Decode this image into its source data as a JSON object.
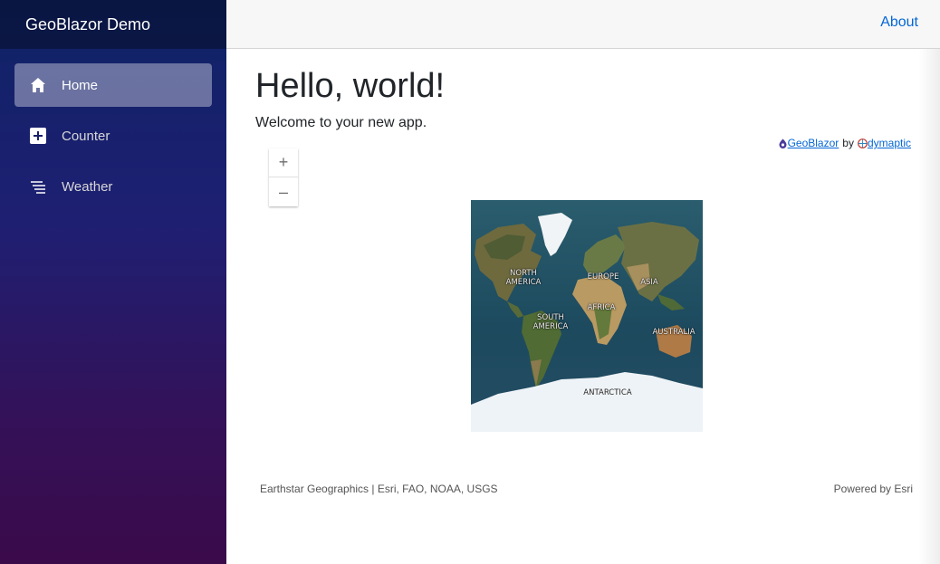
{
  "brand": {
    "title": "GeoBlazor Demo"
  },
  "nav": {
    "items": [
      {
        "label": "Home",
        "icon": "home-icon",
        "active": true
      },
      {
        "label": "Counter",
        "icon": "plus-square-icon",
        "active": false
      },
      {
        "label": "Weather",
        "icon": "list-lines-icon",
        "active": false
      }
    ]
  },
  "top_bar": {
    "about_label": "About"
  },
  "main": {
    "heading": "Hello, world!",
    "welcome": "Welcome to your new app."
  },
  "credit": {
    "geoblazor_label": " GeoBlazor ",
    "by_label": "by",
    "dymaptic_label": " dymaptic"
  },
  "map": {
    "zoom_in_label": "+",
    "zoom_out_label": "–",
    "labels": {
      "north_america": "NORTH\nAMERICA",
      "europe": "EUROPE",
      "asia": "ASIA",
      "africa": "AFRICA",
      "south_america": "SOUTH\nAMERICA",
      "australia": "AUSTRALIA",
      "antarctica": "ANTARCTICA"
    },
    "attribution": "Earthstar Geographics | Esri, FAO, NOAA, USGS",
    "powered_by": "Powered by Esri"
  },
  "colors": {
    "accent_link": "#0366d6",
    "sidebar_top": "#0e2366",
    "sidebar_bottom": "#3a0a4a",
    "ocean": "#1f4f63"
  }
}
